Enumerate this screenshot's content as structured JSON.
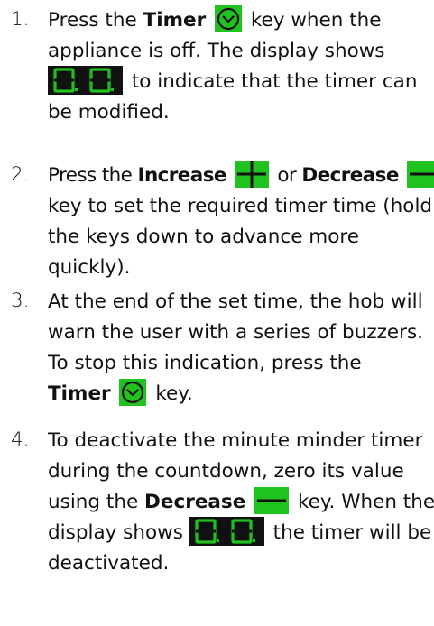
{
  "steps": [
    {
      "number": "1.",
      "l1_a": "Press the",
      "l1_b": "Timer",
      "l1_c": "key when the",
      "l2": "appliance is off. The display shows",
      "l3_b": "to indicate that the timer can",
      "l4": "be modified."
    },
    {
      "number": "2.",
      "l1_a": "Press the",
      "l1_b": "Increase",
      "l1_c": "or",
      "l1_d": "Decrease",
      "l2": "key to set the required timer time (hold",
      "l3": "the keys down to advance more",
      "l4": "quickly)."
    },
    {
      "number": "3.",
      "l1": "At the end of the set time, the hob will",
      "l2": "warn the user with a series of buzzers.",
      "l3": "To stop this indication, press the",
      "l4_a": "Timer",
      "l4_b": "key."
    },
    {
      "number": "4.",
      "l1": "To deactivate the minute minder timer",
      "l2": "during the countdown, zero its value",
      "l3_a": "using the",
      "l3_b": "Decrease",
      "l3_c": "key. When the",
      "l4_a": "display shows",
      "l4_b": "the timer will be",
      "l5": "deactivated."
    }
  ],
  "display_reading": "0.0.",
  "icons": {
    "timer_key": "timer-chevron-icon",
    "increase_key": "plus-icon",
    "decrease_key": "minus-icon",
    "display": "seven-segment-display-icon"
  },
  "colors": {
    "key_green": "#1fc21f",
    "display_green": "#1fc21f",
    "text": "#111111"
  }
}
